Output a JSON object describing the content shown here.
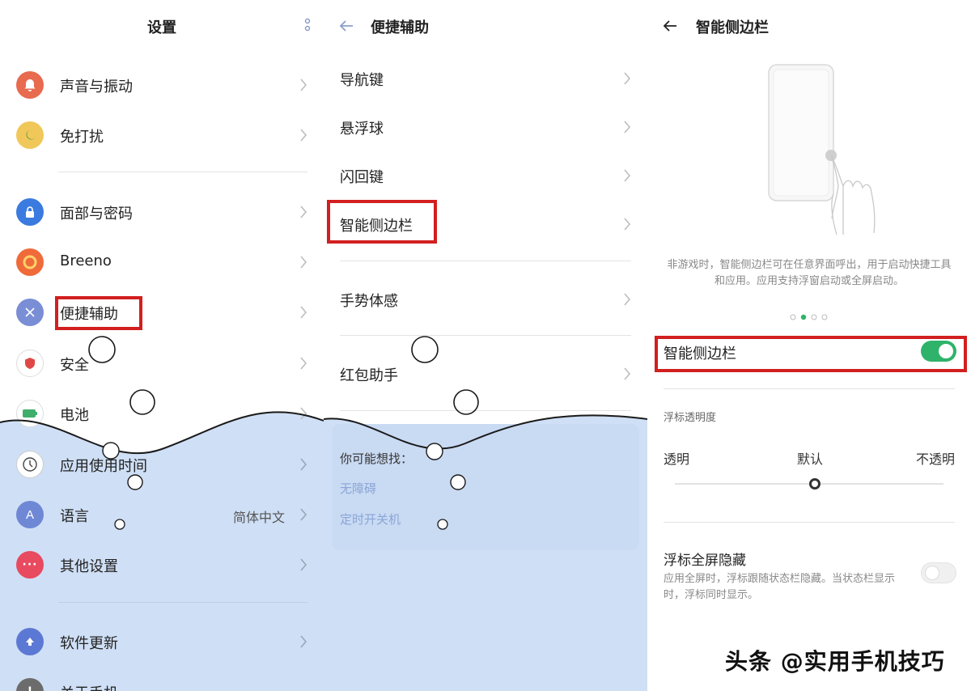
{
  "panel1": {
    "title": "设置",
    "items": [
      {
        "label": "声音与振动",
        "icon": "bell-icon",
        "color": "#e86a4f"
      },
      {
        "label": "免打扰",
        "icon": "moon-icon",
        "color": "#f0c85a"
      },
      {
        "label": "面部与密码",
        "icon": "lock-icon",
        "color": "#3b7be0"
      },
      {
        "label": "Breeno",
        "icon": "breeno-icon",
        "color": "#ef6b3a"
      },
      {
        "label": "便捷辅助",
        "icon": "assist-icon",
        "color": "#7a8ed6"
      },
      {
        "label": "安全",
        "icon": "shield-icon",
        "color": "#e04848"
      },
      {
        "label": "电池",
        "icon": "battery-icon",
        "color": "#3fae6a"
      },
      {
        "label": "应用使用时间",
        "icon": "clock-icon",
        "color": "#ffffff"
      },
      {
        "label": "语言",
        "value": "简体中文",
        "icon": "language-icon",
        "color": "#6f88d6"
      },
      {
        "label": "其他设置",
        "icon": "more-icon",
        "color": "#e84a5f"
      },
      {
        "label": "软件更新",
        "icon": "update-icon",
        "color": "#5b79d4"
      },
      {
        "label": "关于手机",
        "icon": "info-icon",
        "color": "#6c6c6c"
      }
    ]
  },
  "panel2": {
    "title": "便捷辅助",
    "items": [
      {
        "label": "导航键"
      },
      {
        "label": "悬浮球"
      },
      {
        "label": "闪回键"
      },
      {
        "label": "智能侧边栏"
      },
      {
        "label": "手势体感"
      },
      {
        "label": "红包助手"
      }
    ],
    "suggest": {
      "title": "你可能想找：",
      "links": [
        "无障碍",
        "定时开关机"
      ]
    }
  },
  "panel3": {
    "title": "智能侧边栏",
    "description": "非游戏时，智能侧边栏可在任意界面呼出，用于启动快捷工具和应用。应用支持浮窗启动或全屏启动。",
    "toggle_label": "智能侧边栏",
    "toggle_on": true,
    "section_title": "浮标透明度",
    "slider": {
      "left": "透明",
      "center": "默认",
      "right": "不透明",
      "value_percent": 52
    },
    "float": {
      "title": "浮标全屏隐藏",
      "description": "应用全屏时，浮标跟随状态栏隐藏。当状态栏显示时，浮标同时显示。",
      "on": false
    }
  },
  "watermark": "头条 @实用手机技巧",
  "colors": {
    "accent_green": "#2fb36a",
    "highlight_red": "#d21f1f",
    "wave_blue": "#cfdff5"
  }
}
